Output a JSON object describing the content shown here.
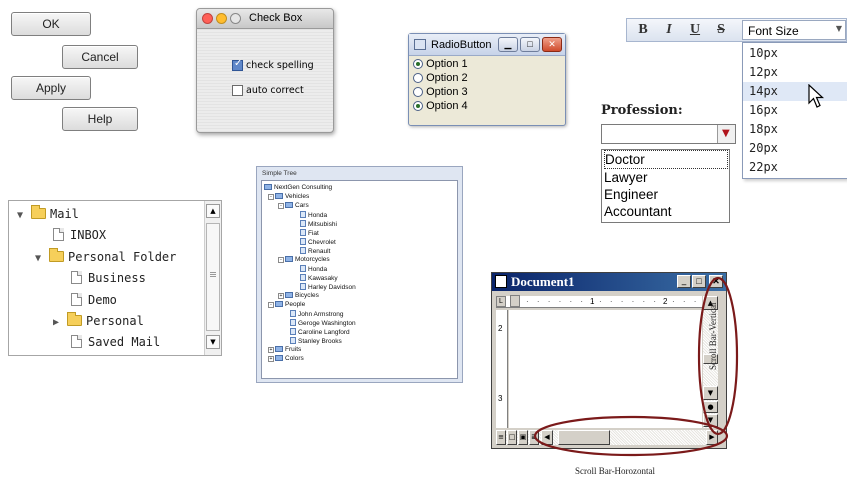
{
  "buttons": {
    "ok": "OK",
    "cancel": "Cancel",
    "apply": "Apply",
    "help": "Help"
  },
  "checkbox_window": {
    "title": "Check Box",
    "items": [
      {
        "label": "check spelling",
        "checked": true
      },
      {
        "label": "auto correct",
        "checked": false
      }
    ]
  },
  "radio_window": {
    "title": "RadioButton",
    "options": [
      {
        "label": "Option 1",
        "selected": true
      },
      {
        "label": "Option 2",
        "selected": false
      },
      {
        "label": "Option 3",
        "selected": false
      },
      {
        "label": "Option 4",
        "selected": true
      }
    ]
  },
  "toolbar": {
    "bold": "B",
    "italic": "I",
    "underline": "U",
    "strike": "S",
    "font_size_label": "Font Size",
    "font_sizes": [
      "10px",
      "12px",
      "14px",
      "16px",
      "18px",
      "20px",
      "22px"
    ],
    "hovered": "14px"
  },
  "profession": {
    "label": "Profession:",
    "value": "",
    "options": [
      "Doctor",
      "Lawyer",
      "Engineer",
      "Accountant"
    ],
    "focused": "Doctor"
  },
  "mail_tree": {
    "root": "Mail",
    "inbox": "INBOX",
    "personal_folder": "Personal Folder",
    "business": "Business",
    "demo": "Demo",
    "personal": "Personal",
    "saved_mail": "Saved Mail"
  },
  "simple_tree": {
    "title": "Simple Tree",
    "root": "NextGen Consulting",
    "vehicles": "Vehicles",
    "cars": "Cars",
    "car_items": [
      "Honda",
      "Mitsubishi",
      "Fiat",
      "Chevrolet",
      "Renault"
    ],
    "motorcycles": "Motorcycles",
    "motorcycle_items": [
      "Honda",
      "Kawasaky",
      "Harley Davidson"
    ],
    "bicycles": "Bicycles",
    "people": "People",
    "people_items": [
      "John Armstrong",
      "Geroge Washington",
      "Caroline Langford",
      "Stanley Brooks"
    ],
    "fruits": "Fruits",
    "colors": "Colors"
  },
  "document_window": {
    "title": "Document1",
    "ruler_marks": [
      "1",
      "2"
    ],
    "vertical_ruler_marks": [
      "2",
      "3"
    ],
    "annotation_vertical": "Scroll Bar-Vertical",
    "annotation_horizontal": "Scroll Bar-Horozontal"
  },
  "colors": {
    "annotation_ellipse": "#7b1a1a",
    "highlight": "#3a6ea5"
  }
}
